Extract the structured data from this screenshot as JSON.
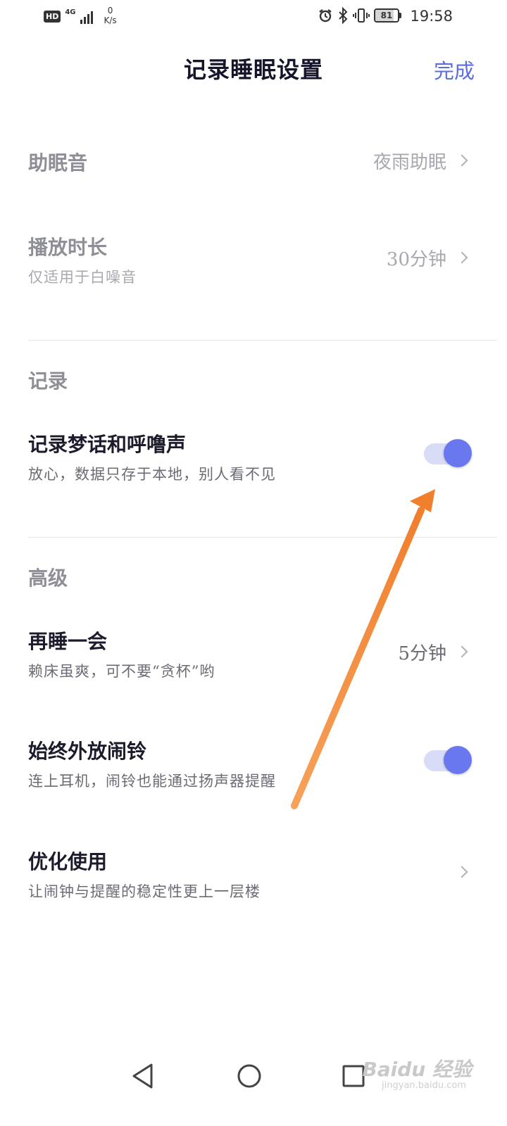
{
  "status_bar": {
    "hd": "HD",
    "network": "4G",
    "speed_value": "0",
    "speed_unit": "K/s",
    "battery": "81",
    "battery_level": 0.81,
    "time": "19:58"
  },
  "header": {
    "title": "记录睡眠设置",
    "done_label": "完成"
  },
  "rows": {
    "sleep_sound": {
      "title": "助眠音",
      "value": "夜雨助眠"
    },
    "play_duration": {
      "title": "播放时长",
      "subtitle": "仅适用于白噪音",
      "value": "30分钟"
    },
    "record_sleep_talk": {
      "title": "记录梦话和呼噜声",
      "subtitle": "放心，数据只存于本地，别人看不见",
      "enabled": true
    },
    "snooze": {
      "title": "再睡一会",
      "subtitle": "赖床虽爽，可不要“贪杯”哟",
      "value": "5分钟"
    },
    "speaker_alarm": {
      "title": "始终外放闹铃",
      "subtitle": "连上耳机，闹铃也能通过扬声器提醒",
      "enabled": true
    },
    "optimize": {
      "title": "优化使用",
      "subtitle": "让闹钟与提醒的稳定性更上一层楼"
    }
  },
  "sections": {
    "record": "记录",
    "advanced": "高级"
  },
  "watermark": {
    "brand": "Baidu 经验",
    "url": "jingyan.baidu.com"
  },
  "colors": {
    "accent": "#6a78ef",
    "toggle_track": "#d8dcf6",
    "arrow": "#f48a3c"
  }
}
